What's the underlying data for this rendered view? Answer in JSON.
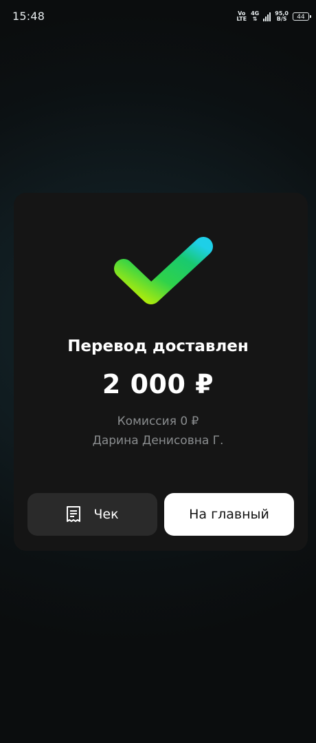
{
  "status_bar": {
    "time": "15:48",
    "volte_top": "Vo",
    "volte_bottom": "LTE",
    "network": "4G",
    "speed_value": "95,0",
    "speed_unit": "B/S",
    "battery": "44"
  },
  "result": {
    "title": "Перевод доставлен",
    "amount": "2 000 ₽",
    "fee": "Комиссия 0 ₽",
    "recipient": "Дарина Денисовна Г."
  },
  "actions": {
    "receipt_label": "Чек",
    "home_label": "На главный"
  },
  "colors": {
    "check_gradient": [
      "#c6f000",
      "#21c75a",
      "#1ecfe8"
    ],
    "card_bg": "#151515",
    "secondary_button_bg": "#2a2a2a",
    "primary_button_bg": "#ffffff"
  }
}
